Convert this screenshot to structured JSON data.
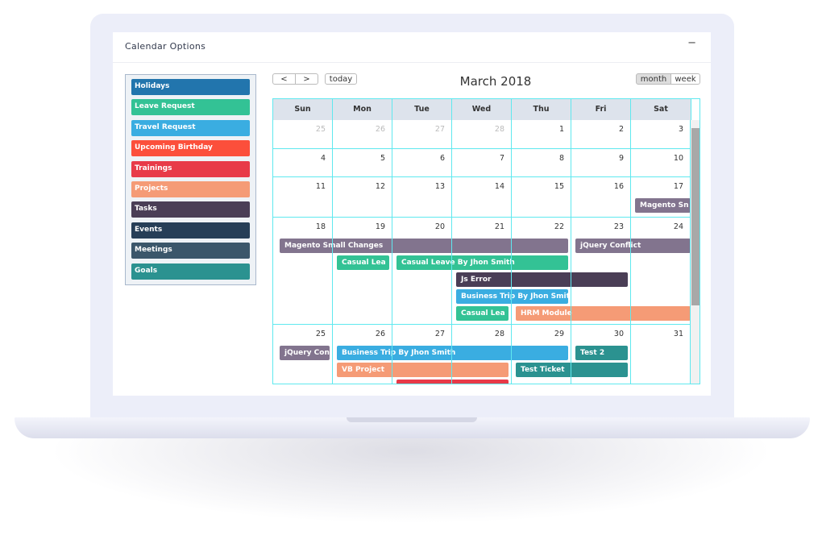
{
  "panel": {
    "title": "Calendar Options",
    "collapse_icon": "−"
  },
  "legend": [
    {
      "label": "Holidays",
      "color": "#2275ad"
    },
    {
      "label": "Leave Request",
      "color": "#33c295"
    },
    {
      "label": "Travel Request",
      "color": "#3aade1"
    },
    {
      "label": "Upcoming Birthday",
      "color": "#fc4f3b"
    },
    {
      "label": "Trainings",
      "color": "#e83a48"
    },
    {
      "label": "Projects",
      "color": "#f59b76"
    },
    {
      "label": "Tasks",
      "color": "#4a3e56"
    },
    {
      "label": "Events",
      "color": "#263e57"
    },
    {
      "label": "Meetings",
      "color": "#3b566a"
    },
    {
      "label": "Goals",
      "color": "#2b9290"
    }
  ],
  "toolbar": {
    "prev": "<",
    "next": ">",
    "today": "today",
    "title": "March 2018",
    "month": "month",
    "week": "week"
  },
  "days": [
    "Sun",
    "Mon",
    "Tue",
    "Wed",
    "Thu",
    "Fri",
    "Sat"
  ],
  "weeks": [
    [
      {
        "d": "25",
        "other": true
      },
      {
        "d": "26",
        "other": true
      },
      {
        "d": "27",
        "other": true
      },
      {
        "d": "28",
        "other": true
      },
      {
        "d": "1"
      },
      {
        "d": "2"
      },
      {
        "d": "3"
      }
    ],
    [
      {
        "d": "4"
      },
      {
        "d": "5"
      },
      {
        "d": "6"
      },
      {
        "d": "7"
      },
      {
        "d": "8"
      },
      {
        "d": "9"
      },
      {
        "d": "10"
      }
    ],
    [
      {
        "d": "11"
      },
      {
        "d": "12"
      },
      {
        "d": "13"
      },
      {
        "d": "14"
      },
      {
        "d": "15"
      },
      {
        "d": "16"
      },
      {
        "d": "17"
      }
    ],
    [
      {
        "d": "18"
      },
      {
        "d": "19"
      },
      {
        "d": "20"
      },
      {
        "d": "21"
      },
      {
        "d": "22"
      },
      {
        "d": "23"
      },
      {
        "d": "24"
      }
    ],
    [
      {
        "d": "25"
      },
      {
        "d": "26"
      },
      {
        "d": "27"
      },
      {
        "d": "28"
      },
      {
        "d": "29"
      },
      {
        "d": "30"
      },
      {
        "d": "31"
      }
    ]
  ],
  "events": [
    {
      "title": "Magento Sn",
      "color": "#82748e",
      "start": "Mar 17",
      "end": "Mar 17"
    },
    {
      "title": "Magento Small Changes",
      "color": "#82748e",
      "start": "Mar 18",
      "end": "Mar 22"
    },
    {
      "title": "jQuery Conflict",
      "color": "#82748e",
      "start": "Mar 23",
      "end": "Mar 24"
    },
    {
      "title": "Casual Lea",
      "color": "#33c295",
      "start": "Mar 19",
      "end": "Mar 19"
    },
    {
      "title": "Casual Leave By Jhon Smith",
      "color": "#33c295",
      "start": "Mar 20",
      "end": "Mar 22"
    },
    {
      "title": "Js Error",
      "color": "#4a3e56",
      "start": "Mar 21",
      "end": "Mar 23"
    },
    {
      "title": "Business Trip By Jhon Smit",
      "color": "#3aade1",
      "start": "Mar 21",
      "end": "Mar 22"
    },
    {
      "title": "Casual Lea",
      "color": "#33c295",
      "start": "Mar 21",
      "end": "Mar 21"
    },
    {
      "title": "HRM Module",
      "color": "#f59b76",
      "start": "Mar 22",
      "end": "Mar 24"
    },
    {
      "title": "jQuery Con",
      "color": "#82748e",
      "start": "Mar 25",
      "end": "Mar 25"
    },
    {
      "title": "Business Trip By Jhon Smith",
      "color": "#3aade1",
      "start": "Mar 26",
      "end": "Mar 29"
    },
    {
      "title": "Test 2",
      "color": "#2b9290",
      "start": "Mar 30",
      "end": "Mar 30"
    },
    {
      "title": "VB Project",
      "color": "#f59b76",
      "start": "Mar 26",
      "end": "Mar 28"
    },
    {
      "title": "Test Ticket",
      "color": "#2b9290",
      "start": "Mar 29",
      "end": "Mar 30"
    },
    {
      "title": "",
      "color": "#e83a48",
      "start": "Mar 27",
      "end": "Mar 28"
    }
  ]
}
